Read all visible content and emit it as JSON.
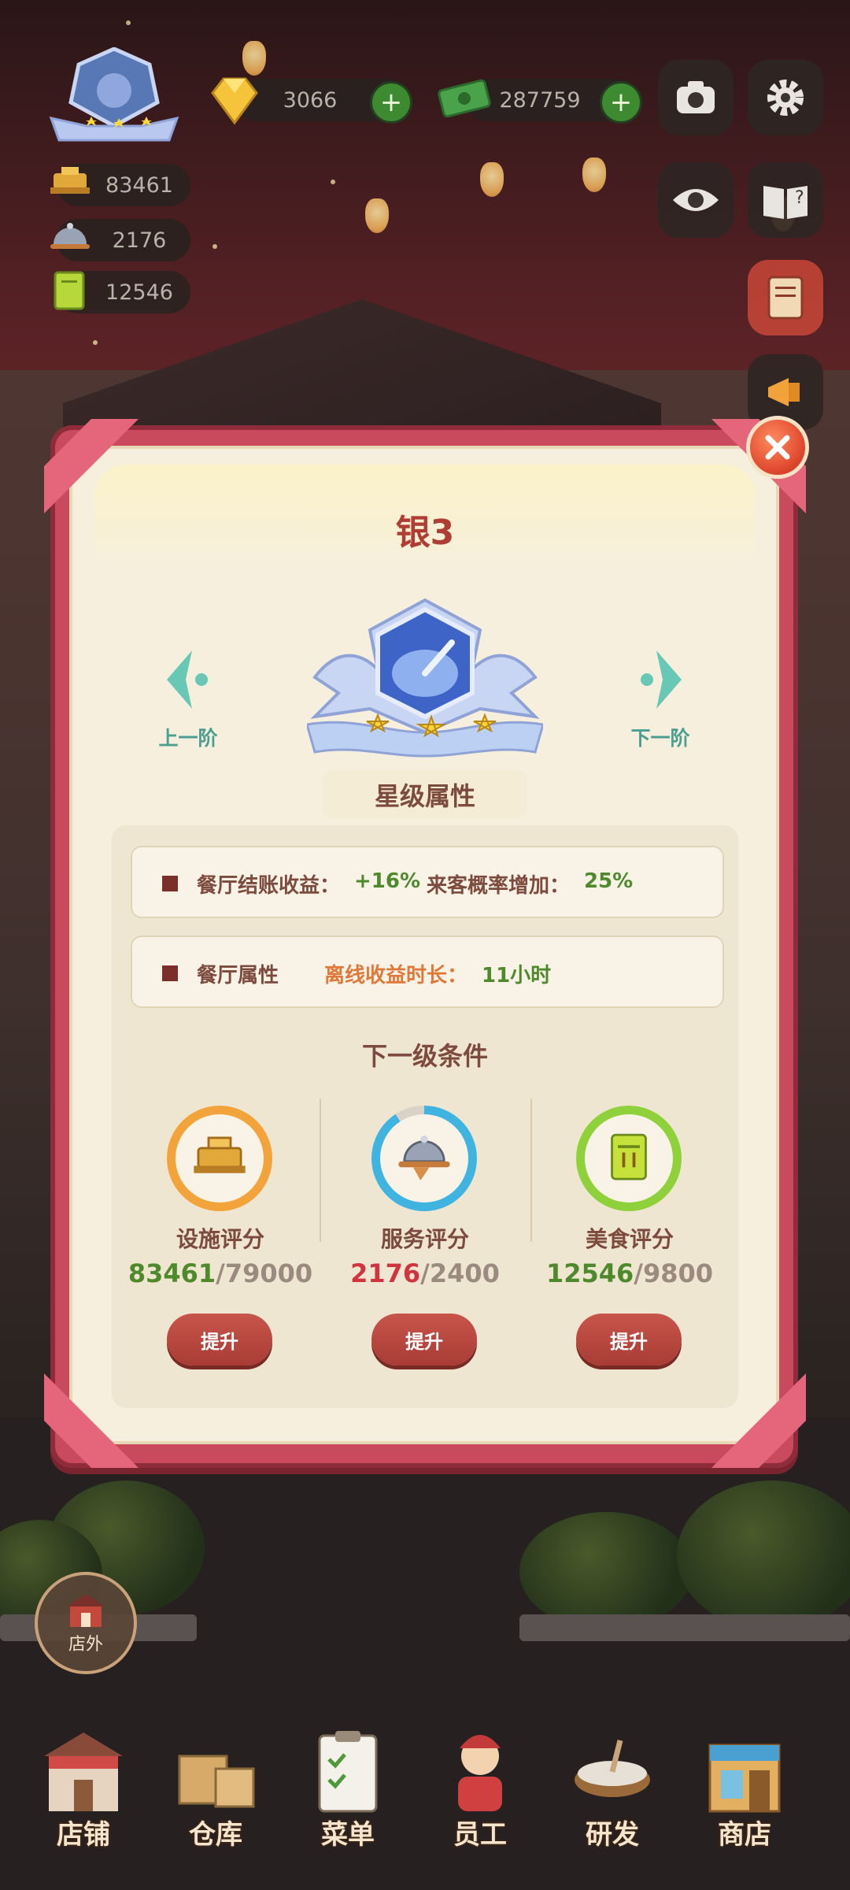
{
  "hud": {
    "diamonds": "3066",
    "cash": "287759",
    "facility_score": "83461",
    "service_score": "2176",
    "food_score": "12546"
  },
  "modal": {
    "title": "银3",
    "prev_label": "上一阶",
    "next_label": "下一阶",
    "star_section_title": "星级属性",
    "attr_row1": {
      "label": "餐厅结账收益：",
      "value1": "+16%",
      "label2": "来客概率增加：",
      "value2": "25%"
    },
    "attr_row2": {
      "label": "餐厅属性",
      "offline_label": "离线收益时长：",
      "offline_value": "11小时"
    },
    "next_level_title": "下一级条件",
    "stats": [
      {
        "label": "设施评分",
        "current": "83461",
        "target": "/79000",
        "upgrade": "提升",
        "progress": 1.0
      },
      {
        "label": "服务评分",
        "current": "2176",
        "target": "/2400",
        "upgrade": "提升",
        "progress": 0.907
      },
      {
        "label": "美食评分",
        "current": "12546",
        "target": "/9800",
        "upgrade": "提升",
        "progress": 1.0
      }
    ]
  },
  "outside_button": "店外",
  "bottom_nav": [
    "店铺",
    "仓库",
    "菜单",
    "员工",
    "研发",
    "商店"
  ],
  "colors": {
    "met": "#4e8a2c",
    "unmet": "#d0343f",
    "ring_facility": "#f2a43a",
    "ring_service": "#3fb4e0",
    "ring_food": "#8fd13a"
  }
}
